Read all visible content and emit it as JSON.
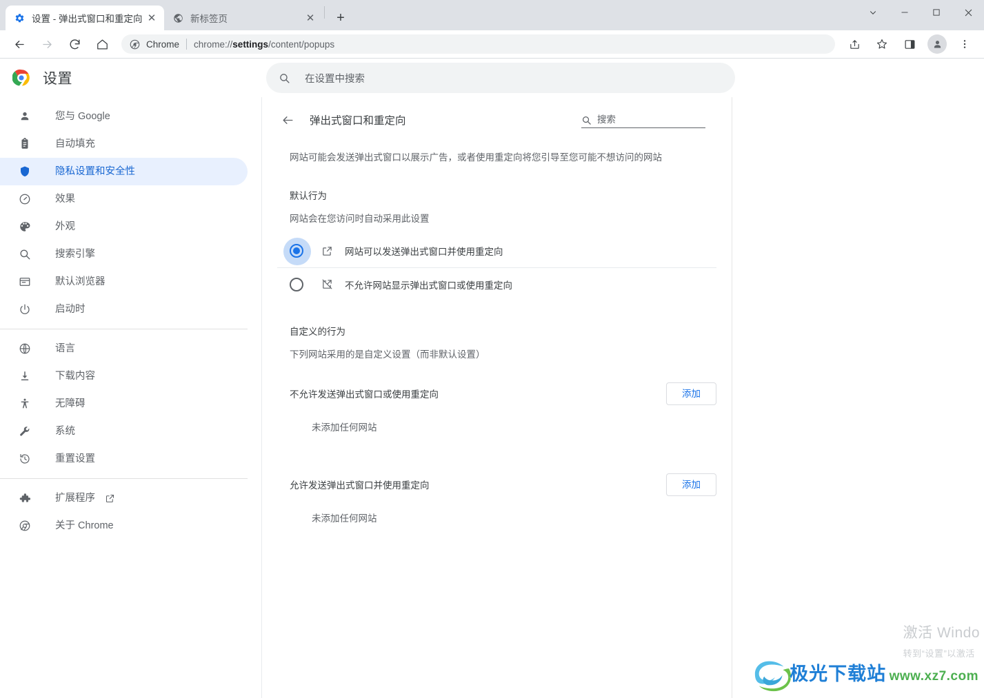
{
  "window": {
    "controls": {
      "expand_label": "v",
      "minimize_label": "—",
      "maximize_label": "□",
      "close_label": "✕"
    }
  },
  "tabs": [
    {
      "title": "设置 - 弹出式窗口和重定向",
      "favicon": "gear-icon",
      "active": true,
      "close_label": "✕"
    },
    {
      "title": "新标签页",
      "favicon": "globe-icon",
      "active": false,
      "close_label": "✕"
    }
  ],
  "newtab_label": "+",
  "toolbar": {
    "back_label": "←",
    "forward_label": "→",
    "reload_label": "⟳",
    "home_label": "⌂",
    "omnibox": {
      "scheme_label": "Chrome",
      "url_prefix": "chrome://",
      "url_bold": "settings",
      "url_suffix": "/content/popups"
    },
    "share_label": "share-icon",
    "bookmark_label": "star-icon",
    "sidepanel_label": "side-panel-icon",
    "profile_label": "avatar-icon",
    "menu_label": "⋮"
  },
  "settings_header": {
    "title": "设置",
    "search_placeholder": "在设置中搜索"
  },
  "sidebar": {
    "groups": [
      {
        "items": [
          {
            "label": "您与 Google",
            "icon": "person-icon",
            "selected": false
          },
          {
            "label": "自动填充",
            "icon": "clipboard-icon",
            "selected": false
          },
          {
            "label": "隐私设置和安全性",
            "icon": "shield-icon",
            "selected": true
          },
          {
            "label": "效果",
            "icon": "speedometer-icon",
            "selected": false
          },
          {
            "label": "外观",
            "icon": "palette-icon",
            "selected": false
          },
          {
            "label": "搜索引擎",
            "icon": "search-icon",
            "selected": false
          },
          {
            "label": "默认浏览器",
            "icon": "browser-window-icon",
            "selected": false
          },
          {
            "label": "启动时",
            "icon": "power-icon",
            "selected": false
          }
        ]
      },
      {
        "items": [
          {
            "label": "语言",
            "icon": "globe-icon",
            "selected": false
          },
          {
            "label": "下载内容",
            "icon": "download-icon",
            "selected": false
          },
          {
            "label": "无障碍",
            "icon": "accessibility-icon",
            "selected": false
          },
          {
            "label": "系统",
            "icon": "wrench-icon",
            "selected": false
          },
          {
            "label": "重置设置",
            "icon": "history-restore-icon",
            "selected": false
          }
        ]
      },
      {
        "items": [
          {
            "label": "扩展程序",
            "icon": "puzzle-icon",
            "selected": false,
            "external": true
          },
          {
            "label": "关于 Chrome",
            "icon": "chrome-icon",
            "selected": false
          }
        ]
      }
    ]
  },
  "content": {
    "back_label": "←",
    "title": "弹出式窗口和重定向",
    "search_label": "搜索",
    "description": "网站可能会发送弹出式窗口以展示广告，或者使用重定向将您引导至您可能不想访问的网站",
    "default_behavior": {
      "heading": "默认行为",
      "subtext": "网站会在您访问时自动采用此设置",
      "options": [
        {
          "label": "网站可以发送弹出式窗口并使用重定向",
          "icon": "open-in-new-icon",
          "checked": true
        },
        {
          "label": "不允许网站显示弹出式窗口或使用重定向",
          "icon": "open-in-new-off-icon",
          "checked": false
        }
      ]
    },
    "custom_behavior": {
      "heading": "自定义的行为",
      "subtext": "下列网站采用的是自定义设置（而非默认设置）",
      "blocks": [
        {
          "label": "不允许发送弹出式窗口或使用重定向",
          "button": "添加",
          "empty": "未添加任何网站"
        },
        {
          "label": "允许发送弹出式窗口并使用重定向",
          "button": "添加",
          "empty": "未添加任何网站"
        }
      ]
    }
  },
  "watermarks": {
    "windows_line1": "激活 Windo",
    "windows_line2": "转到“设置”以激活",
    "site_name": "极光下载站",
    "site_url": "www.xz7.com"
  },
  "colors": {
    "accent": "#1a73e8",
    "selected_bg": "#e8f0fe",
    "selected_text": "#1967d2",
    "tabstrip_bg": "#dee1e6",
    "omnibox_bg": "#f1f3f4"
  }
}
